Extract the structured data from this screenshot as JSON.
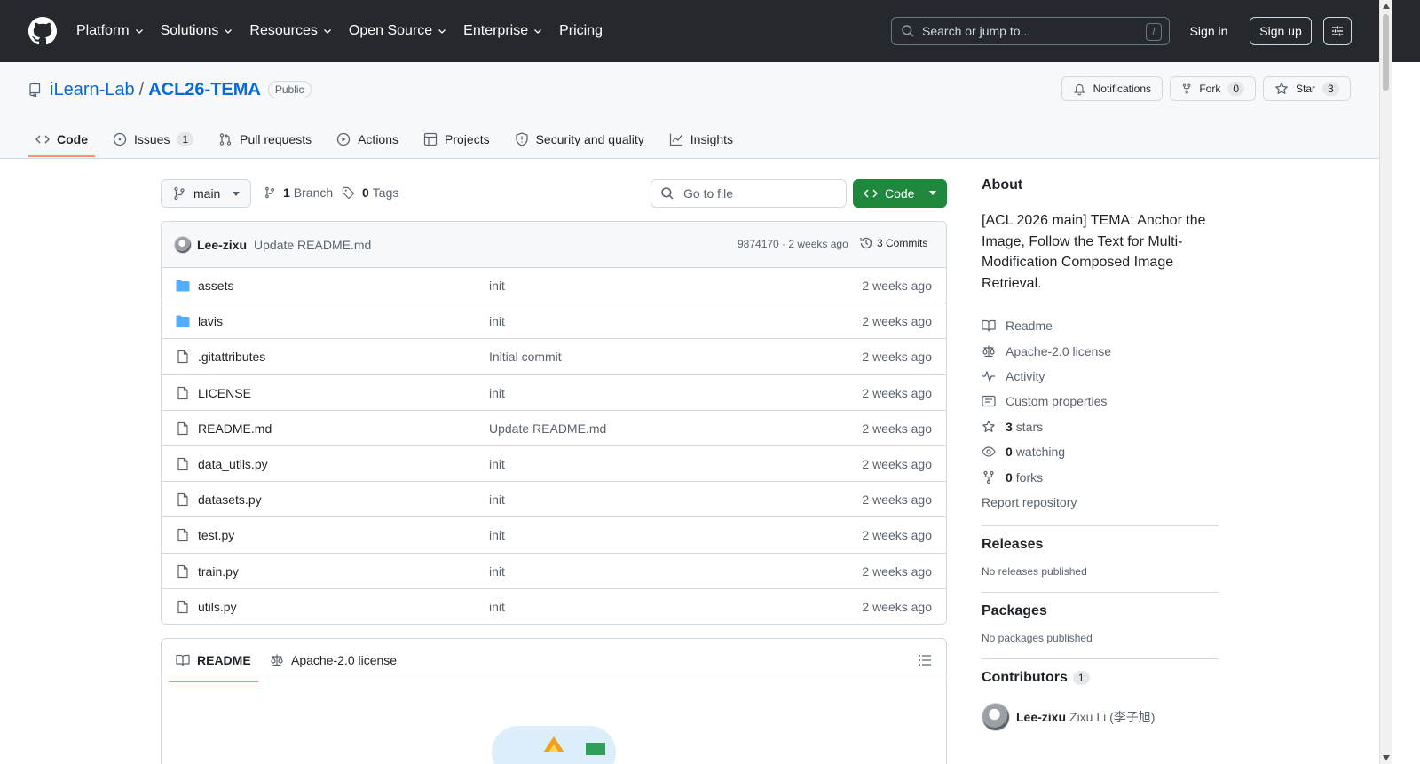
{
  "header": {
    "nav": [
      "Platform",
      "Solutions",
      "Resources",
      "Open Source",
      "Enterprise",
      "Pricing"
    ],
    "search_placeholder": "Search or jump to...",
    "search_shortcut": "/",
    "signin": "Sign in",
    "signup": "Sign up"
  },
  "repo": {
    "owner": "iLearn-Lab",
    "separator": "/",
    "name": "ACL26-TEMA",
    "visibility": "Public",
    "notifications": "Notifications",
    "fork_label": "Fork",
    "fork_count": "0",
    "star_label": "Star",
    "star_count": "3"
  },
  "tabs": [
    {
      "label": "Code",
      "icon": "code-icon"
    },
    {
      "label": "Issues",
      "count": "1",
      "icon": "issue-icon"
    },
    {
      "label": "Pull requests",
      "icon": "pull-request-icon"
    },
    {
      "label": "Actions",
      "icon": "play-icon"
    },
    {
      "label": "Projects",
      "icon": "table-icon"
    },
    {
      "label": "Security and quality",
      "icon": "shield-icon"
    },
    {
      "label": "Insights",
      "icon": "graph-icon"
    }
  ],
  "toolbar": {
    "branch": "main",
    "branch_count": "1",
    "branch_label": "Branch",
    "tag_count": "0",
    "tag_label": "Tags",
    "goto_placeholder": "Go to file",
    "code_button": "Code"
  },
  "last_commit": {
    "author": "Lee-zixu",
    "message": "Update README.md",
    "meta": "9874170 · 2 weeks ago",
    "commits": "3 Commits"
  },
  "files": [
    {
      "name": "assets",
      "type": "dir",
      "message": "init",
      "age": "2 weeks ago"
    },
    {
      "name": "lavis",
      "type": "dir",
      "message": "init",
      "age": "2 weeks ago"
    },
    {
      "name": ".gitattributes",
      "type": "file",
      "message": "Initial commit",
      "age": "2 weeks ago"
    },
    {
      "name": "LICENSE",
      "type": "file",
      "message": "init",
      "age": "2 weeks ago"
    },
    {
      "name": "README.md",
      "type": "file",
      "message": "Update README.md",
      "age": "2 weeks ago"
    },
    {
      "name": "data_utils.py",
      "type": "file",
      "message": "init",
      "age": "2 weeks ago"
    },
    {
      "name": "datasets.py",
      "type": "file",
      "message": "init",
      "age": "2 weeks ago"
    },
    {
      "name": "test.py",
      "type": "file",
      "message": "init",
      "age": "2 weeks ago"
    },
    {
      "name": "train.py",
      "type": "file",
      "message": "init",
      "age": "2 weeks ago"
    },
    {
      "name": "utils.py",
      "type": "file",
      "message": "init",
      "age": "2 weeks ago"
    }
  ],
  "readme": {
    "tab_readme": "README",
    "tab_license": "Apache-2.0 license"
  },
  "about": {
    "title": "About",
    "description": "[ACL 2026 main] TEMA: Anchor the Image, Follow the Text for Multi-Modification Composed Image Retrieval.",
    "readme": "Readme",
    "license": "Apache-2.0 license",
    "activity": "Activity",
    "custom_properties": "Custom properties",
    "stars_count": "3",
    "stars_label": "stars",
    "watching_count": "0",
    "watching_label": "watching",
    "forks_count": "0",
    "forks_label": "forks",
    "report": "Report repository"
  },
  "releases": {
    "title": "Releases",
    "note": "No releases published"
  },
  "packages": {
    "title": "Packages",
    "note": "No packages published"
  },
  "contributors": {
    "title": "Contributors",
    "count": "1",
    "login": "Lee-zixu",
    "fullname": "Zixu Li (李子旭)"
  },
  "colors": {
    "header_bg": "#25292e",
    "accent": "#0969da",
    "primary_button": "#1f883d",
    "tab_underline": "#fd8c73",
    "folder": "#54aeff"
  }
}
